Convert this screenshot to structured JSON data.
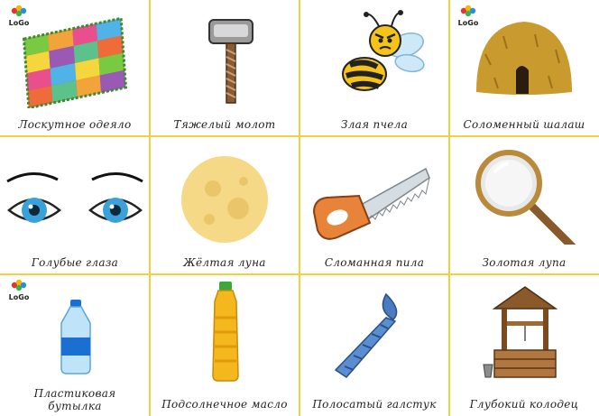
{
  "logo": {
    "text": "LoGo"
  },
  "cards": [
    {
      "id": "quilt",
      "label": "Лоскутное одеяло",
      "icon": "patchwork-quilt-icon",
      "logo": true
    },
    {
      "id": "hammer",
      "label": "Тяжелый молот",
      "icon": "hammer-icon",
      "logo": false
    },
    {
      "id": "bee",
      "label": "Злая пчела",
      "icon": "angry-bee-icon",
      "logo": false
    },
    {
      "id": "hut",
      "label": "Соломенный шалаш",
      "icon": "straw-hut-icon",
      "logo": true
    },
    {
      "id": "eyes",
      "label": "Голубые глаза",
      "icon": "blue-eyes-icon",
      "logo": false
    },
    {
      "id": "moon",
      "label": "Жёлтая луна",
      "icon": "yellow-moon-icon",
      "logo": false
    },
    {
      "id": "saw",
      "label": "Сломанная пила",
      "icon": "broken-saw-icon",
      "logo": false
    },
    {
      "id": "magnifier",
      "label": "Золотая лупа",
      "icon": "magnifying-glass-icon",
      "logo": false
    },
    {
      "id": "bottle",
      "label_line1": "Пластиковая",
      "label_line2": "бутылка",
      "icon": "plastic-bottle-icon",
      "logo": true
    },
    {
      "id": "oil",
      "label": "Подсолнечное масло",
      "icon": "sunflower-oil-icon",
      "logo": false
    },
    {
      "id": "tie",
      "label": "Полосатый галстук",
      "icon": "striped-tie-icon",
      "logo": false
    },
    {
      "id": "well",
      "label": "Глубокий колодец",
      "icon": "water-well-icon",
      "logo": false
    }
  ]
}
